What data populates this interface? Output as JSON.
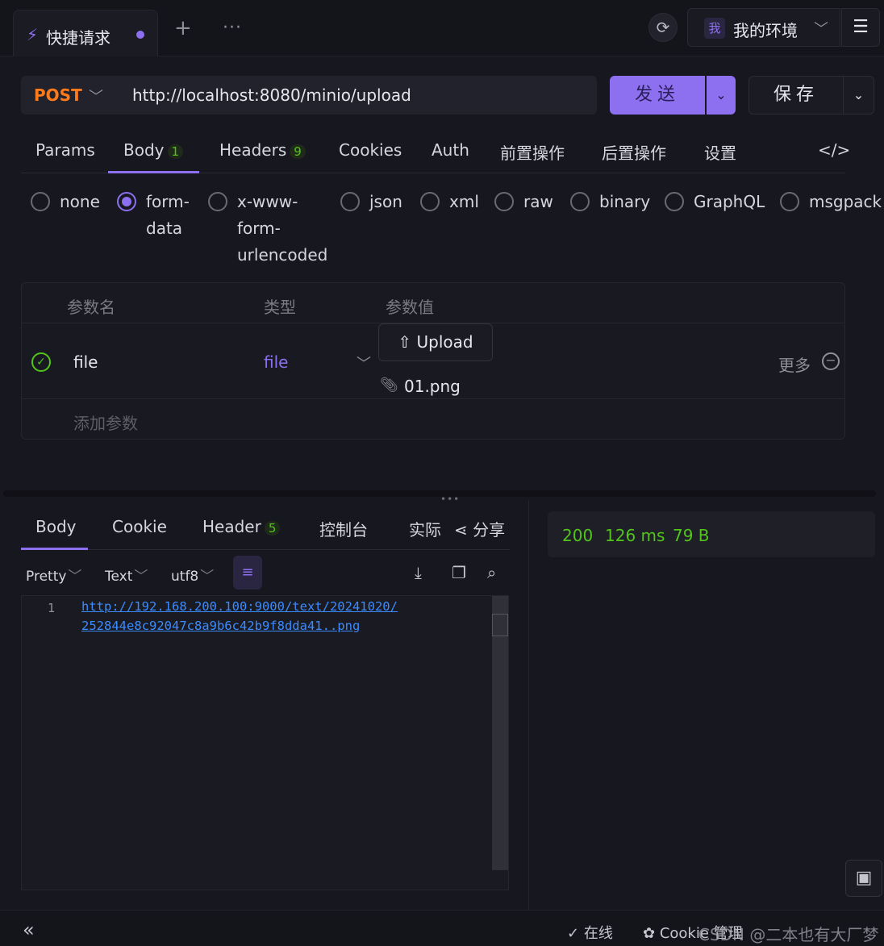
{
  "tab": {
    "icon": "lightning-icon",
    "title": "快捷请求"
  },
  "topbar": {
    "refresh_icon": "refresh-icon",
    "env_badge": "我",
    "env_label": "我的环境",
    "menu_icon": "hamburger-icon"
  },
  "request": {
    "method": "POST",
    "url": "http://localhost:8080/minio/upload",
    "send_label": "发送",
    "save_label": "保存"
  },
  "req_tabs": [
    {
      "label": "Params"
    },
    {
      "label": "Body",
      "count": "1"
    },
    {
      "label": "Headers",
      "count": "9"
    },
    {
      "label": "Cookies"
    },
    {
      "label": "Auth"
    },
    {
      "label": "前置操作"
    },
    {
      "label": "后置操作"
    },
    {
      "label": "设置"
    }
  ],
  "body_types": [
    "none",
    "form-data",
    "x-www-form-urlencoded",
    "json",
    "xml",
    "raw",
    "binary",
    "GraphQL",
    "msgpack"
  ],
  "body_types_display": {
    "form_data_1": "form-",
    "form_data_2": "data",
    "xw_1": "x-www-",
    "xw_2": "form-",
    "xw_3": "urlencoded"
  },
  "body_type_selected": "form-data",
  "params_table": {
    "headers": [
      "参数名",
      "类型",
      "参数值"
    ],
    "row": {
      "name": "file",
      "type": "file",
      "upload_label": "Upload",
      "file_name": "01.png",
      "more_label": "更多"
    },
    "add_label": "添加参数"
  },
  "response_tabs": [
    {
      "label": "Body"
    },
    {
      "label": "Cookie"
    },
    {
      "label": "Header",
      "count": "5"
    },
    {
      "label": "控制台"
    },
    {
      "label": "实际"
    },
    {
      "label": "分享"
    }
  ],
  "format": {
    "pretty": "Pretty",
    "text": "Text",
    "encoding": "utf8"
  },
  "code": {
    "line_number": "1",
    "line1": "http://192.168.200.100:9000/text/20241020/",
    "line2": "252844e8c92047c8a9b6c42b9f8dda41..png"
  },
  "status": {
    "code": "200",
    "time": "126 ms",
    "size": "79 B"
  },
  "footer": {
    "online": "在线",
    "cookie": "Cookie 管理",
    "overlay": "CSDN @二本也有大厂梦"
  },
  "colors": {
    "accent": "#8c70f0",
    "method": "#ff7a1a",
    "success": "#52c41a",
    "link": "#3b8cff"
  }
}
